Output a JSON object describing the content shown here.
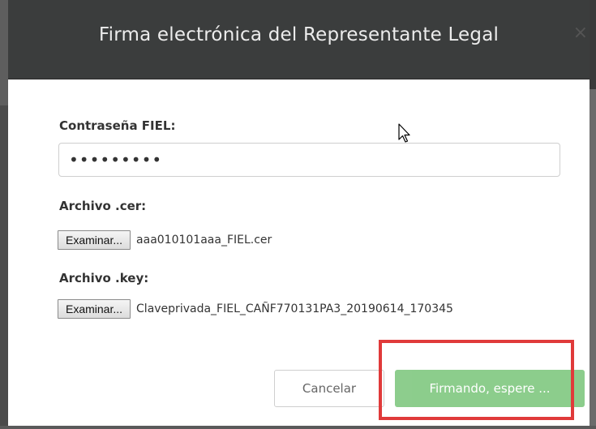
{
  "dialog": {
    "title": "Firma electrónica del Representante Legal",
    "close_glyph": "×"
  },
  "form": {
    "password": {
      "label": "Contraseña FIEL:",
      "masked_value": "•••••••••"
    },
    "cer_file": {
      "label": "Archivo .cer:",
      "button_label": "Examinar...",
      "file_name": "aaa010101aaa_FIEL.cer"
    },
    "key_file": {
      "label": "Archivo .key:",
      "button_label": "Examinar...",
      "file_name": "Claveprivada_FIEL_CAÑF770131PA3_20190614_170345"
    }
  },
  "footer": {
    "cancel_label": "Cancelar",
    "submit_label": "Firmando, espere ..."
  },
  "colors": {
    "header_bg": "#3b3d3d",
    "submit_bg": "#5cb85c",
    "highlight": "#e03a3a"
  },
  "icons": {
    "cursor": "mouse-pointer-icon",
    "close": "close-icon"
  }
}
